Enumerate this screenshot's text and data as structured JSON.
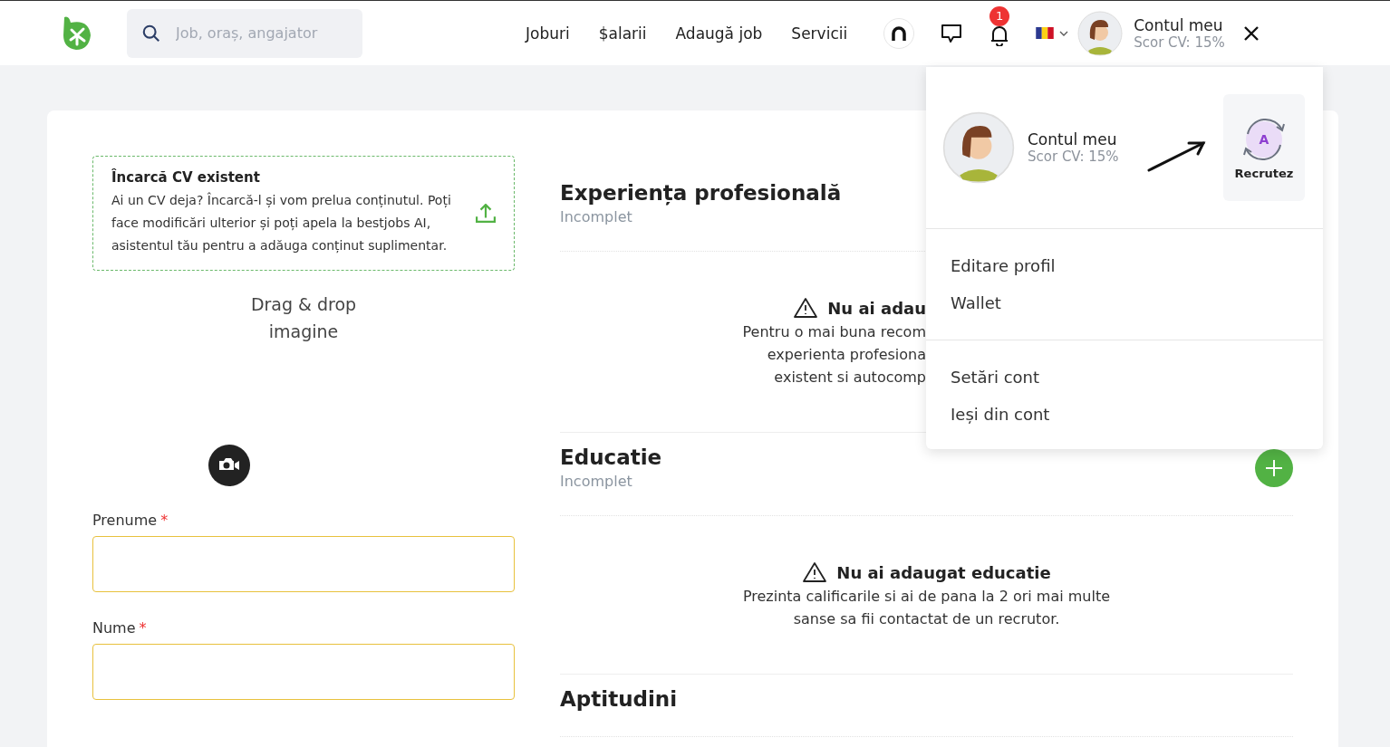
{
  "header": {
    "search": {
      "placeholder": "Job, oraș, angajator"
    },
    "nav": [
      "Joburi",
      "$alarii",
      "Adaugă job",
      "Servicii"
    ],
    "notifications": {
      "badge": "1"
    },
    "account": {
      "title": "Contul meu",
      "score": "Scor CV: 15%"
    }
  },
  "upload": {
    "title": "Încarcă CV existent",
    "text": "Ai un CV deja? Încarcă-l și vom prelua conținutul. Poți face modificări ulterior și poți apela la bestjobs AI, asistentul tău pentru a adăuga conținut suplimentar."
  },
  "photo": {
    "text": "Drag & drop imagine"
  },
  "fields": [
    {
      "label": "Prenume",
      "required": "*"
    },
    {
      "label": "Nume",
      "required": "*"
    }
  ],
  "sections": [
    {
      "title": "Experiența profesională",
      "status": "Incomplet",
      "covered": true,
      "empty": {
        "title": "Nu ai adau",
        "lines": [
          "Pentru o mai buna recom",
          "experienta profesiona",
          "existent si autocomp"
        ]
      }
    },
    {
      "title": "Educatie",
      "status": "Incomplet",
      "covered": false,
      "empty": {
        "title": "Nu ai adaugat educatie",
        "lines": [
          "Prezinta calificarile si ai de pana la 2 ori mai multe",
          "sanse sa fii contactat de un recrutor."
        ]
      }
    },
    {
      "title": "Aptitudini"
    }
  ],
  "dropdown": {
    "title": "Contul meu",
    "score": "Scor CV: 15%",
    "switch": {
      "letter": "A",
      "label": "Recrutez"
    },
    "groups": [
      [
        "Editare profil",
        "Wallet"
      ],
      [
        "Setări cont",
        "Ieși din cont"
      ]
    ]
  }
}
